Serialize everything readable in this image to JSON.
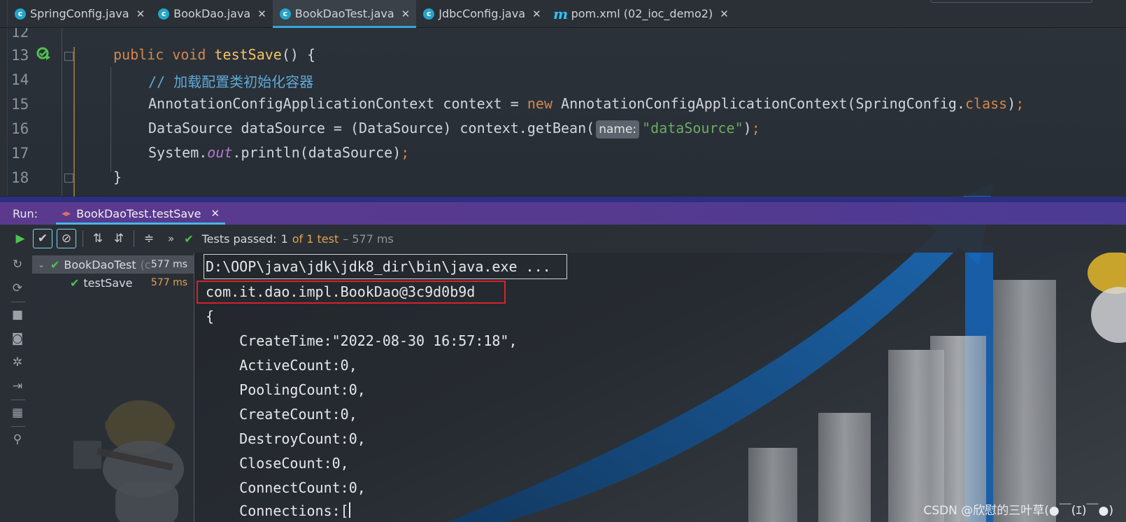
{
  "tabs": [
    {
      "icon": "c",
      "label": "SpringConfig.java",
      "active": false
    },
    {
      "icon": "c",
      "label": "BookDao.java",
      "active": false
    },
    {
      "icon": "c",
      "label": "BookDaoTest.java",
      "active": true
    },
    {
      "icon": "c",
      "label": "JdbcConfig.java",
      "active": false
    },
    {
      "icon": "m",
      "label": "pom.xml (02_ioc_demo2)",
      "active": false
    }
  ],
  "editor": {
    "line_numbers": [
      "12",
      "13",
      "14",
      "15",
      "16",
      "17",
      "18"
    ],
    "lines": {
      "l13": {
        "kw1": "public",
        "kw2": "void",
        "fn": "testSave",
        "rest": "() {"
      },
      "l14": {
        "comment": "// 加载配置类初始化容器"
      },
      "l15": {
        "a": "AnnotationConfigApplicationContext context = ",
        "kw": "new",
        "b": " AnnotationConfigApplicationContext(SpringConfig.",
        "kw2": "class",
        "c": ")",
        "semi": ";"
      },
      "l16": {
        "a": "DataSource dataSource = (DataSource) context.getBean(",
        "hint": "name:",
        "str": "\"dataSource\"",
        "c": ")",
        "semi": ";"
      },
      "l17": {
        "a": "System.",
        "field": "out",
        "b": ".println(dataSource)",
        "semi": ";"
      },
      "l18": {
        "a": "}"
      }
    }
  },
  "run": {
    "label": "Run:",
    "tab_label": "BookDaoTest.testSave",
    "status": {
      "passed": "Tests passed:",
      "count": "1",
      "of": "of 1 test",
      "time": "– 577 ms"
    }
  },
  "tree": [
    {
      "label": "BookDaoTest",
      "dim": "(c",
      "time": "577 ms",
      "selected": true
    },
    {
      "label": "testSave",
      "time": "577 ms",
      "selected": false
    }
  ],
  "console": {
    "lines": [
      "D:\\OOP\\java\\jdk\\jdk8_dir\\bin\\java.exe ...",
      "com.it.dao.impl.BookDao@3c9d0b9d",
      "{",
      "    CreateTime:\"2022-08-30 16:57:18\",",
      "    ActiveCount:0,",
      "    PoolingCount:0,",
      "    CreateCount:0,",
      "    DestroyCount:0,",
      "    CloseCount:0,",
      "    ConnectCount:0,",
      "    Connections:["
    ]
  },
  "watermark": "CSDN @欣慰的三叶草(●￣(ｴ)￣●)"
}
